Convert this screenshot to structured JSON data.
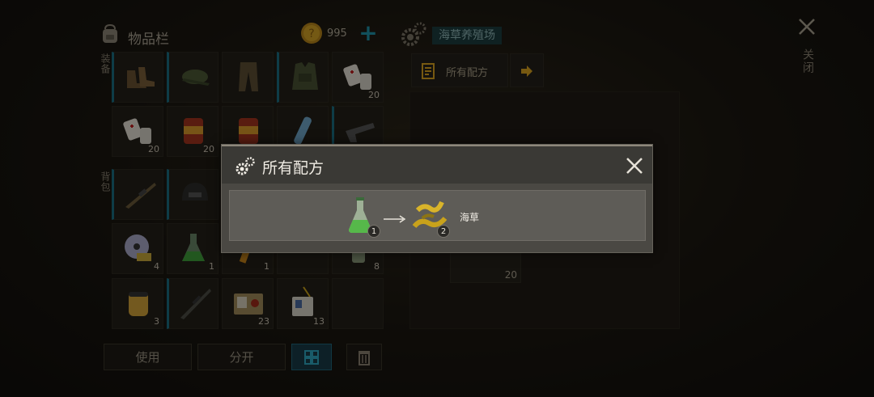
{
  "inventory": {
    "title": "物品栏",
    "coins": "995",
    "add_label": "+",
    "side_labels": [
      "装备",
      "背包"
    ],
    "items": [
      {
        "name": "boots",
        "qty": ""
      },
      {
        "name": "cap",
        "qty": ""
      },
      {
        "name": "pants",
        "qty": ""
      },
      {
        "name": "vest",
        "qty": ""
      },
      {
        "name": "pills",
        "qty": "20"
      },
      {
        "name": "pills",
        "qty": "20"
      },
      {
        "name": "canned-food",
        "qty": "20"
      },
      {
        "name": "canned-food",
        "qty": ""
      },
      {
        "name": "water-bottle",
        "qty": ""
      },
      {
        "name": "pistol",
        "qty": ""
      },
      {
        "name": "rifle",
        "qty": ""
      },
      {
        "name": "helmet",
        "qty": ""
      },
      {
        "name": "",
        "qty": ""
      },
      {
        "name": "",
        "qty": ""
      },
      {
        "name": "",
        "qty": ""
      },
      {
        "name": "disc",
        "qty": "4"
      },
      {
        "name": "flask",
        "qty": "1"
      },
      {
        "name": "bullets",
        "qty": "1"
      },
      {
        "name": "",
        "qty": ""
      },
      {
        "name": "bottle",
        "qty": "8"
      },
      {
        "name": "filter",
        "qty": "3"
      },
      {
        "name": "sniper-rifle",
        "qty": ""
      },
      {
        "name": "biohazard-card",
        "qty": "23"
      },
      {
        "name": "id-badge",
        "qty": "13"
      },
      {
        "name": "",
        "qty": ""
      }
    ],
    "buttons": {
      "use": "使用",
      "split": "分开",
      "sort": "",
      "trash": ""
    }
  },
  "station": {
    "name": "海草养殖场",
    "recipes_tab": "所有配方",
    "slot_qty": "20"
  },
  "close": {
    "label": "关闭"
  },
  "modal": {
    "title": "所有配方",
    "recipe": {
      "input_qty": "1",
      "output_qty": "2",
      "output_name": "海草"
    }
  },
  "colors": {
    "accent": "#1f93a8",
    "gold": "#d9a21f",
    "modal_bg": "#4a4843"
  }
}
